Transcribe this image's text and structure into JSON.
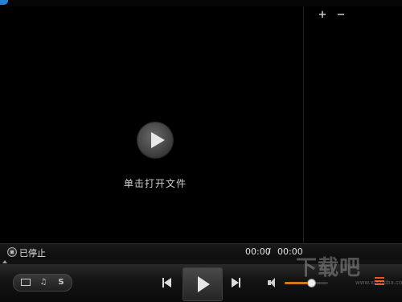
{
  "video": {
    "open_file_text": "单击打开文件"
  },
  "sidebar": {
    "add_label": "+",
    "remove_label": "−"
  },
  "status": {
    "state_text": "已停止",
    "current_time": "00:00",
    "separator": "/",
    "total_time": "00:00"
  },
  "controls": {
    "mode_buttons": [
      {
        "icon": "monitor-icon",
        "label": ""
      },
      {
        "icon": "music-note-icon",
        "label": "♫"
      },
      {
        "icon": "s-icon",
        "label": "S"
      }
    ],
    "volume_level": 0.62,
    "accent_color": "#d07a1e"
  },
  "watermark": {
    "text": "下载吧",
    "url": "www.xiazaiba.com"
  }
}
